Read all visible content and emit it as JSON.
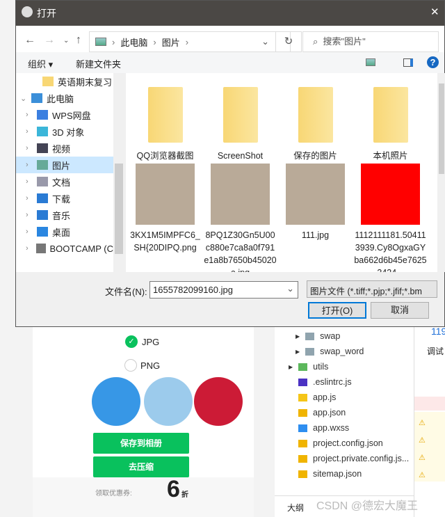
{
  "dialog": {
    "title": "打开",
    "close": "✕",
    "nav": {
      "path": [
        "此电脑",
        "图片"
      ],
      "search_placeholder": "搜索\"图片\""
    },
    "toolbar": {
      "organize": "组织 ▾",
      "new_folder": "新建文件夹"
    },
    "tree": [
      {
        "label": "英语期末复习",
        "icon": "folder-icon"
      },
      {
        "label": "此电脑",
        "icon": "computer-icon",
        "expanded": true
      },
      {
        "label": "WPS网盘",
        "icon": "cloud-icon"
      },
      {
        "label": "3D 对象",
        "icon": "cube-icon"
      },
      {
        "label": "视频",
        "icon": "video-icon"
      },
      {
        "label": "图片",
        "icon": "picture-icon",
        "selected": true
      },
      {
        "label": "文档",
        "icon": "document-icon"
      },
      {
        "label": "下载",
        "icon": "download-icon"
      },
      {
        "label": "音乐",
        "icon": "music-icon"
      },
      {
        "label": "桌面",
        "icon": "desktop-icon"
      },
      {
        "label": "BOOTCAMP (C",
        "icon": "drive-icon"
      }
    ],
    "items": [
      {
        "label": "QQ浏览器截图",
        "type": "folder"
      },
      {
        "label": "ScreenShot",
        "type": "folder"
      },
      {
        "label": "保存的图片",
        "type": "folder"
      },
      {
        "label": "本机照片",
        "type": "folder"
      },
      {
        "label": "3KX1M5IMPFC6_SH{20DIPQ.png",
        "type": "image"
      },
      {
        "label": "8PQ1Z30Gn5U00c880e7ca8a0f791e1a8b7650b45020a.jpg",
        "type": "image"
      },
      {
        "label": "111.jpg",
        "type": "image"
      },
      {
        "label": "1112111181.504113939.Cy8OgxaGYba662d6b45e76253424...",
        "type": "image"
      }
    ],
    "filename_label": "文件名(N):",
    "filename_value": "1655782099160.jpg",
    "filetype": "图片文件 (*.tiff;*.pjp;*.jfif;*.bm",
    "open": "打开(O)",
    "cancel": "取消"
  },
  "preview": {
    "opt_jpg": "JPG",
    "opt_png": "PNG",
    "colors": [
      "#3797e6",
      "#9ccbec",
      "#cc1b36"
    ],
    "save": "保存到相册",
    "compress": "去压缩",
    "coupon": "领取优惠券:",
    "discount": "6",
    "discount_unit": "折"
  },
  "files": [
    {
      "name": "swap",
      "icon": "folder-icon"
    },
    {
      "name": "swap_word",
      "icon": "folder-icon"
    },
    {
      "name": "utils",
      "icon": "folder-icon"
    },
    {
      "name": ".eslintrc.js",
      "icon": "eslint-icon"
    },
    {
      "name": "app.js",
      "icon": "js-icon"
    },
    {
      "name": "app.json",
      "icon": "json-icon"
    },
    {
      "name": "app.wxss",
      "icon": "css-icon"
    },
    {
      "name": "project.config.json",
      "icon": "json-icon"
    },
    {
      "name": "project.private.config.js...",
      "icon": "json-icon"
    },
    {
      "name": "sitemap.json",
      "icon": "json-icon"
    }
  ],
  "outline": "大纲",
  "watermark": "CSDN @德宏大魔王",
  "devtools": {
    "tab": "调试",
    "num": "119"
  }
}
